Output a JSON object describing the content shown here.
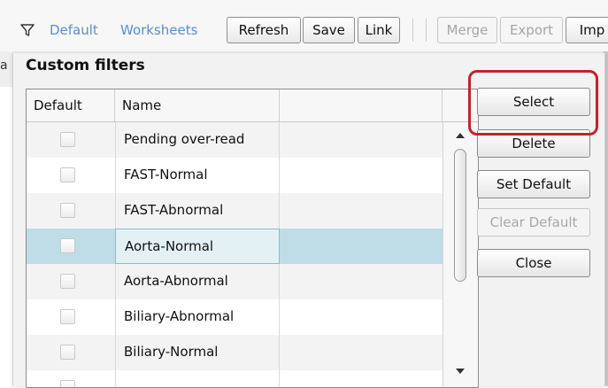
{
  "toolbar": {
    "filter_icon": "filter-funnel-icon",
    "default_link": "Default",
    "worksheets_link": "Worksheets",
    "refresh_label": "Refresh",
    "save_label": "Save",
    "link_label": "Link",
    "merge_label": "Merge",
    "export_label": "Export",
    "import_label": "Imp"
  },
  "background": {
    "partial_text": "a"
  },
  "dialog": {
    "title": "Custom filters",
    "columns": {
      "default": "Default",
      "name": "Name"
    },
    "rows": [
      {
        "name": "Pending over-read",
        "default": false
      },
      {
        "name": "FAST-Normal",
        "default": false
      },
      {
        "name": "FAST-Abnormal",
        "default": false
      },
      {
        "name": "Aorta-Normal",
        "default": false,
        "selected": true
      },
      {
        "name": "Aorta-Abnormal",
        "default": false
      },
      {
        "name": "Biliary-Abnormal",
        "default": false
      },
      {
        "name": "Biliary-Normal",
        "default": false
      }
    ],
    "buttons": {
      "select": "Select",
      "delete": "Delete",
      "set_default": "Set Default",
      "clear_default": "Clear Default",
      "close": "Close"
    }
  },
  "colors": {
    "link": "#5b8fc9",
    "selected_row": "#bedde6",
    "highlight": "#c3232c"
  }
}
